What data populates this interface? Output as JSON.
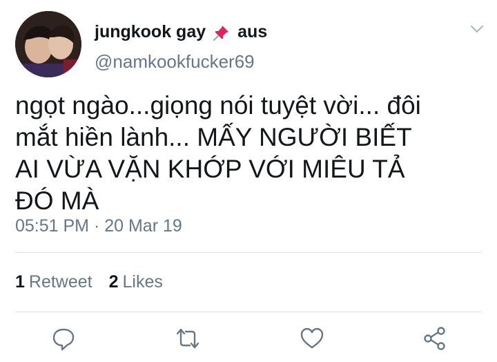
{
  "header": {
    "display_name": "jungkook gay",
    "name_suffix": "aus",
    "handle": "@namkookfucker69"
  },
  "tweet": {
    "text": "ngọt ngào...giọng nói tuyệt vời... đôi\nmắt hiền lành... MẤY NGƯỜI BIẾT\nAI VỪA VẶN KHỚP VỚI MIÊU TẢ\nĐÓ MÀ",
    "timestamp": "05:51 PM · 20 Mar 19"
  },
  "stats": {
    "retweets_count": "1",
    "retweets_label": "Retweet",
    "likes_count": "2",
    "likes_label": "Likes"
  },
  "icons": {
    "pin": "pushpin-icon",
    "menu": "chevron-down-icon",
    "reply": "reply-icon",
    "retweet": "retweet-icon",
    "like": "heart-icon",
    "share": "share-icon"
  },
  "colors": {
    "text": "#14171a",
    "secondary": "#657786",
    "divider": "#d9dfe4",
    "pin": "#e0245e"
  }
}
